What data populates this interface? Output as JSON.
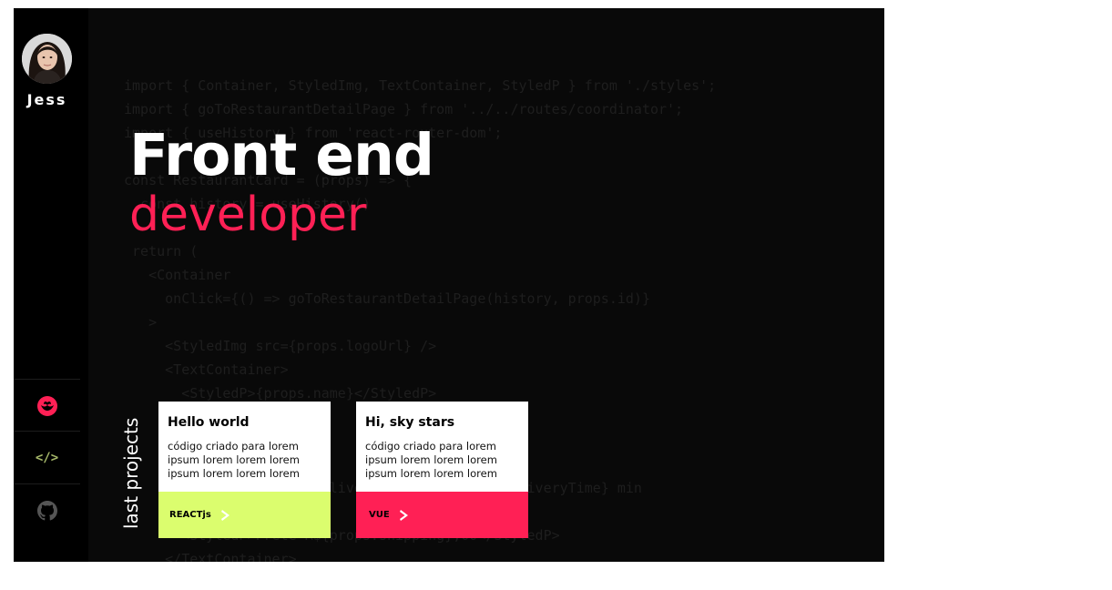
{
  "profile": {
    "name": "Jess",
    "avatar_icon": "person-portrait-icon"
  },
  "nav": [
    {
      "icon": "blossom-logo-icon",
      "color": "#ff2055"
    },
    {
      "icon": "code-brackets-icon",
      "label": "</>",
      "color": "#a6b86a"
    },
    {
      "icon": "github-icon",
      "color": "#555555"
    }
  ],
  "hero": {
    "title_line1": "Front end",
    "title_line2": "developer",
    "accent": "#ff2055"
  },
  "code_lines": [
    "import { Container, StyledImg, TextContainer, StyledP } from './styles';",
    "import { goToRestaurantDetailPage } from '../../routes/coordinator';",
    "import { useHistory } from 'react-router-dom';",
    "",
    "const RestaurantCard = (props) => {",
    "  const history = useHistory()",
    "",
    " return (",
    "   <Container",
    "     onClick={() => goToRestaurantDetailPage(history, props.id)}",
    "   >",
    "     <StyledImg src={props.logoUrl} />",
    "     <TextContainer>",
    "       <StyledP>{props.name}</StyledP>",
    "",
    "",
    "",
    "       <StyledP>{props.deliveryTime} - {props.deliveryTime} min",
    "",
    "       <StyledP>Frete R${props.shipping},00</StyledP>",
    "     </TextContainer>"
  ],
  "projects": {
    "section_label": "last projects",
    "items": [
      {
        "title": "Hello world",
        "description": "código criado para lorem ipsum lorem lorem lorem ipsum lorem lorem lorem",
        "tag": "REACTjs",
        "color": "#dbfd6e"
      },
      {
        "title": "Hi, sky stars",
        "description": "código criado para lorem ipsum lorem lorem lorem ipsum lorem lorem lorem",
        "tag": "VUE",
        "color": "#ff2055"
      }
    ]
  }
}
